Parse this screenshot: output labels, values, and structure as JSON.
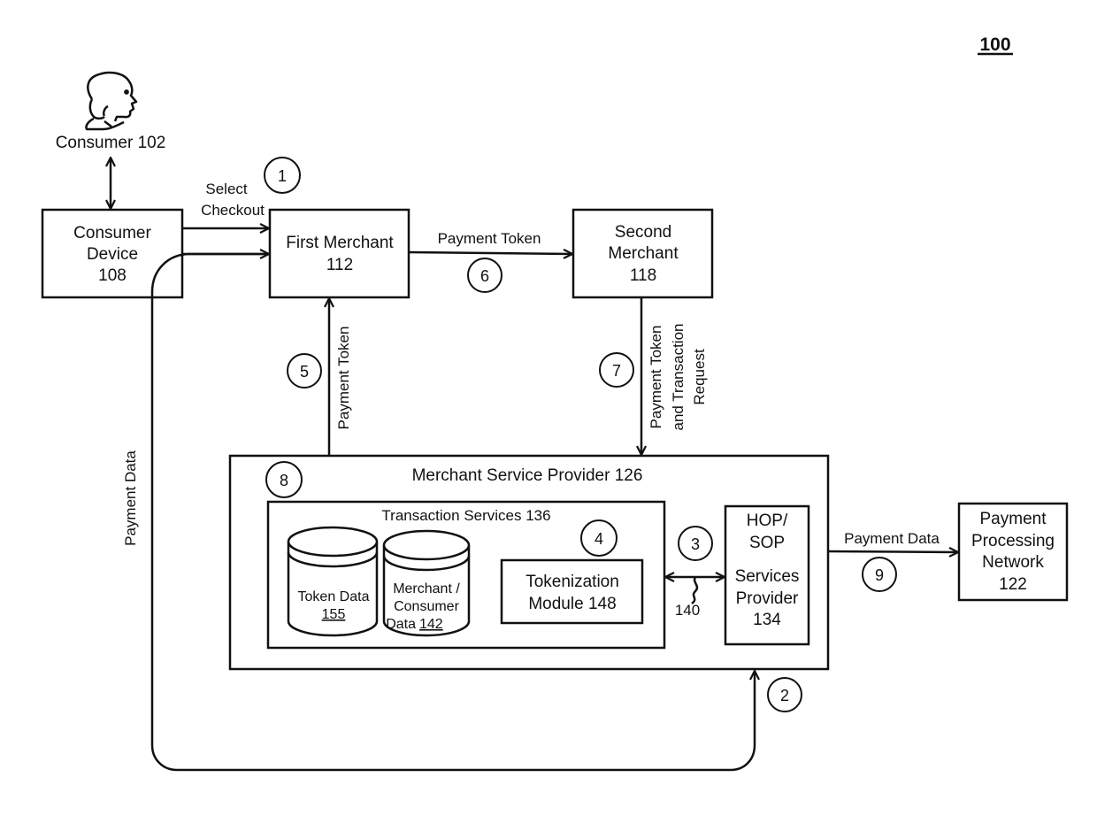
{
  "figure_number": "100",
  "actors": {
    "consumer": "Consumer 102"
  },
  "boxes": {
    "consumer_device": [
      "Consumer",
      "Device",
      "108"
    ],
    "first_merchant": [
      "First Merchant",
      "112"
    ],
    "second_merchant": [
      "Second",
      "Merchant",
      "118"
    ],
    "merchant_service_provider": "Merchant Service Provider 126",
    "transaction_services": "Transaction Services 136",
    "tokenization_module": [
      "Tokenization",
      "Module 148"
    ],
    "hop_sop": [
      "HOP/",
      "SOP",
      "Services",
      "Provider",
      "134"
    ],
    "payment_processing_network": [
      "Payment",
      "Processing",
      "Network",
      "122"
    ]
  },
  "databases": {
    "token_data": {
      "label": "Token Data",
      "ref": "155"
    },
    "merchant_consumer_data": {
      "line1": "Merchant /",
      "line2": "Consumer",
      "label": "Data",
      "ref": "142"
    }
  },
  "arrows": {
    "select_checkout": [
      "Select",
      "Checkout"
    ],
    "payment_token_6": "Payment Token",
    "payment_token_5": "Payment Token",
    "payment_token_7": [
      "Payment Token",
      "and Transaction",
      "Request"
    ],
    "payment_data_left": "Payment Data",
    "payment_data_9": "Payment Data",
    "link_ref": "140"
  },
  "steps": [
    "1",
    "2",
    "3",
    "4",
    "5",
    "6",
    "7",
    "8",
    "9"
  ]
}
